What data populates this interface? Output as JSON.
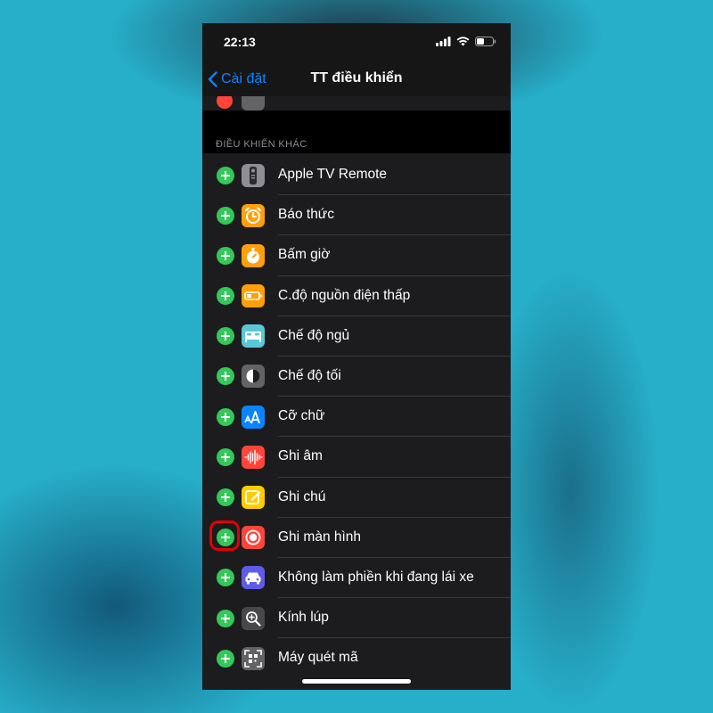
{
  "status_bar": {
    "time": "22:13"
  },
  "nav": {
    "back_label": "Cài đặt",
    "title": "TT điều khiển"
  },
  "section": {
    "header": "ĐIỀU KHIỂN KHÁC"
  },
  "controls": [
    {
      "label": "Apple TV Remote",
      "icon": "tv-remote-icon",
      "color": "#8e8e93"
    },
    {
      "label": "Báo thức",
      "icon": "alarm-clock-icon",
      "color": "#ff9f0a"
    },
    {
      "label": "Bấm giờ",
      "icon": "stopwatch-icon",
      "color": "#ff9f0a"
    },
    {
      "label": "C.độ nguồn điện thấp",
      "icon": "battery-icon",
      "color": "#ff9f0a"
    },
    {
      "label": "Chế độ ngủ",
      "icon": "bed-icon",
      "color": "#5ac8d8"
    },
    {
      "label": "Chế độ tối",
      "icon": "dark-mode-icon",
      "color": "#636366"
    },
    {
      "label": "Cỡ chữ",
      "icon": "text-size-icon",
      "color": "#0a84ff"
    },
    {
      "label": "Ghi âm",
      "icon": "voice-memo-icon",
      "color": "#ff453a"
    },
    {
      "label": "Ghi chú",
      "icon": "notes-icon",
      "color": "#ffcc00"
    },
    {
      "label": "Ghi màn hình",
      "icon": "screen-record-icon",
      "color": "#ff453a",
      "highlighted": true
    },
    {
      "label": "Không làm phiền khi đang lái xe",
      "icon": "car-icon",
      "color": "#5e5ce6"
    },
    {
      "label": "Kính lúp",
      "icon": "magnifier-icon",
      "color": "#48484a"
    },
    {
      "label": "Máy quét mã",
      "icon": "qr-scanner-icon",
      "color": "#636366"
    }
  ],
  "colors": {
    "accent": "#0a84ff",
    "add": "#34c759",
    "highlight": "#e30000"
  }
}
